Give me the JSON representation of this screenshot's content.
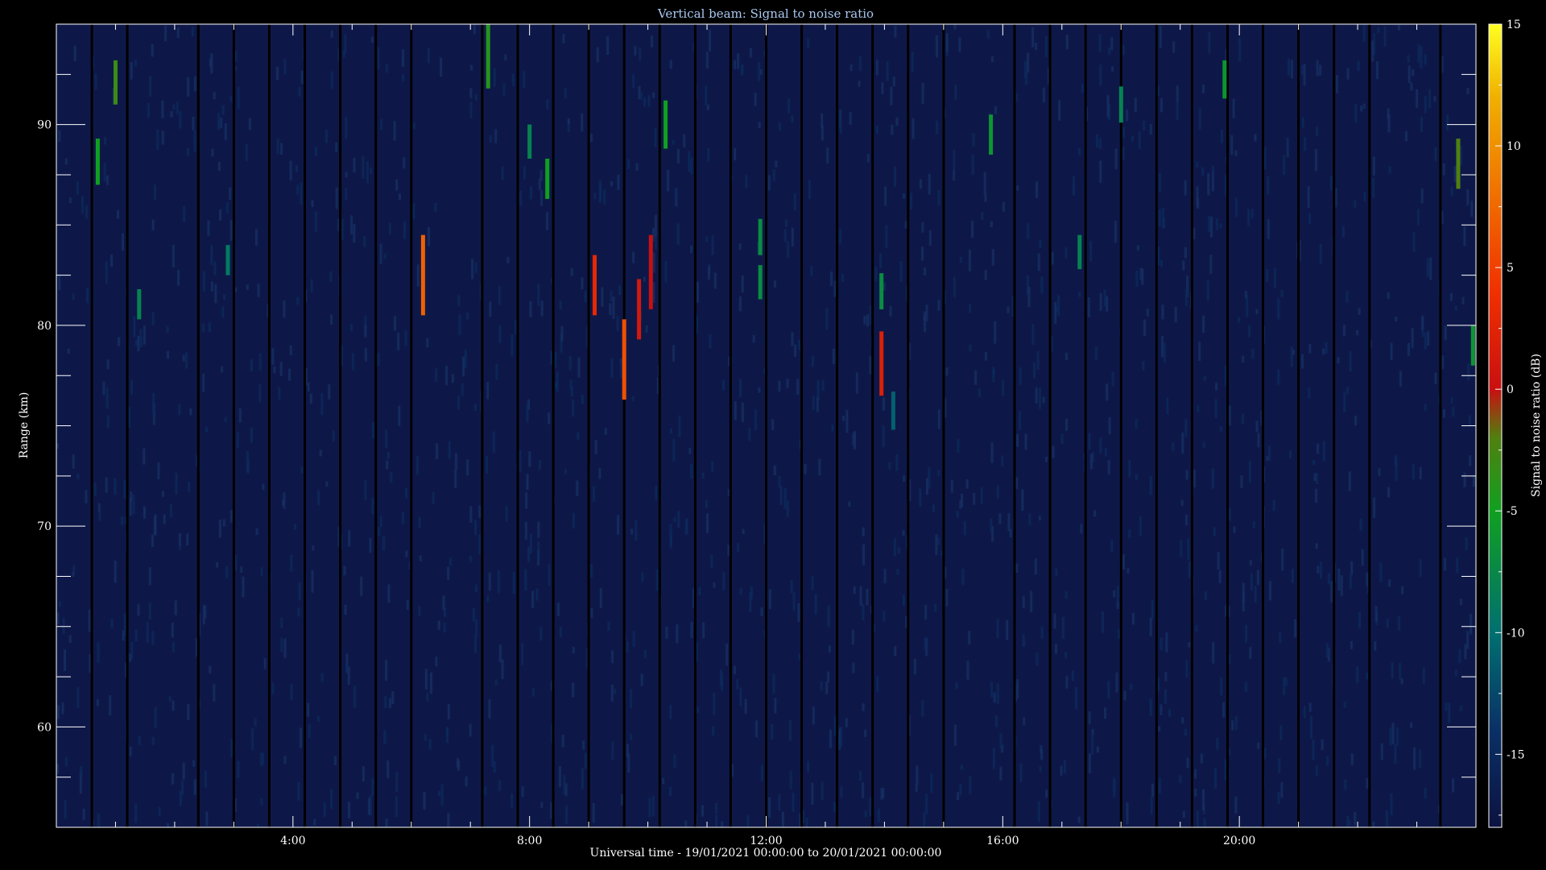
{
  "chart_data": {
    "type": "heatmap",
    "title": "Vertical beam: Signal to noise ratio",
    "xlabel": "Universal time - 19/01/2021 00:00:00 to 20/01/2021 00:00:00",
    "ylabel": "Range (km)",
    "colorbar_label": "Signal to noise ratio (dB)",
    "x_unit": "hours UT",
    "xlim": [
      0,
      24
    ],
    "ylim": [
      55,
      95
    ],
    "clim": [
      -18,
      15
    ],
    "x_ticks": [
      {
        "value": 4,
        "label": "4:00"
      },
      {
        "value": 8,
        "label": "8:00"
      },
      {
        "value": 12,
        "label": "12:00"
      },
      {
        "value": 16,
        "label": "16:00"
      },
      {
        "value": 20,
        "label": "20:00"
      }
    ],
    "y_ticks": [
      {
        "value": 60,
        "label": "60"
      },
      {
        "value": 70,
        "label": "70"
      },
      {
        "value": 80,
        "label": "80"
      },
      {
        "value": 90,
        "label": "90"
      }
    ],
    "colorbar_ticks": [
      {
        "value": 15,
        "label": "15"
      },
      {
        "value": 10,
        "label": "10"
      },
      {
        "value": 5,
        "label": "5"
      },
      {
        "value": 0,
        "label": "0"
      },
      {
        "value": -5,
        "label": "-5"
      },
      {
        "value": -10,
        "label": "-10"
      },
      {
        "value": -15,
        "label": "-15"
      }
    ],
    "colormap": [
      {
        "value": -18,
        "color": "#0c1240"
      },
      {
        "value": -14,
        "color": "#0a3066"
      },
      {
        "value": -10,
        "color": "#007070"
      },
      {
        "value": -5,
        "color": "#10a020"
      },
      {
        "value": -2,
        "color": "#508010"
      },
      {
        "value": 0,
        "color": "#c81010"
      },
      {
        "value": 4,
        "color": "#f03000"
      },
      {
        "value": 8,
        "color": "#f07000"
      },
      {
        "value": 12,
        "color": "#f0b000"
      },
      {
        "value": 15,
        "color": "#ffff20"
      }
    ],
    "background_level_db": -16,
    "data_gaps_hours": [
      0.6,
      1.2,
      2.4,
      3.0,
      3.6,
      4.2,
      4.8,
      5.4,
      6.0,
      7.2,
      7.8,
      8.4,
      9.0,
      9.6,
      10.2,
      10.8,
      11.4,
      12.0,
      12.6,
      13.2,
      13.8,
      14.4,
      15.0,
      16.2,
      16.8,
      17.4,
      18.0,
      18.6,
      19.2,
      19.8,
      20.4,
      21.0,
      21.6,
      22.2,
      23.4
    ],
    "echoes": [
      {
        "t": 0.7,
        "r1": 87.0,
        "r2": 89.3,
        "snr": -5
      },
      {
        "t": 1.0,
        "r1": 91.0,
        "r2": 93.2,
        "snr": -3
      },
      {
        "t": 1.4,
        "r1": 80.3,
        "r2": 81.8,
        "snr": -8
      },
      {
        "t": 2.9,
        "r1": 82.5,
        "r2": 84.0,
        "snr": -9
      },
      {
        "t": 6.2,
        "r1": 80.5,
        "r2": 84.5,
        "snr": 7
      },
      {
        "t": 7.3,
        "r1": 91.8,
        "r2": 95.0,
        "snr": -4
      },
      {
        "t": 8.0,
        "r1": 88.3,
        "r2": 90.0,
        "snr": -8
      },
      {
        "t": 8.3,
        "r1": 86.3,
        "r2": 88.3,
        "snr": -5
      },
      {
        "t": 9.1,
        "r1": 80.5,
        "r2": 83.5,
        "snr": 3
      },
      {
        "t": 9.6,
        "r1": 76.3,
        "r2": 80.3,
        "snr": 6
      },
      {
        "t": 9.85,
        "r1": 79.3,
        "r2": 82.3,
        "snr": 1
      },
      {
        "t": 10.05,
        "r1": 80.8,
        "r2": 84.5,
        "snr": 0
      },
      {
        "t": 10.3,
        "r1": 88.8,
        "r2": 91.2,
        "snr": -5
      },
      {
        "t": 11.9,
        "r1": 83.5,
        "r2": 85.3,
        "snr": -7
      },
      {
        "t": 11.9,
        "r1": 81.3,
        "r2": 83.0,
        "snr": -7
      },
      {
        "t": 13.95,
        "r1": 76.5,
        "r2": 79.7,
        "snr": 2
      },
      {
        "t": 13.95,
        "r1": 80.8,
        "r2": 82.6,
        "snr": -7
      },
      {
        "t": 14.15,
        "r1": 74.8,
        "r2": 76.7,
        "snr": -11
      },
      {
        "t": 15.8,
        "r1": 88.5,
        "r2": 90.5,
        "snr": -6
      },
      {
        "t": 17.3,
        "r1": 82.8,
        "r2": 84.5,
        "snr": -8
      },
      {
        "t": 18.0,
        "r1": 90.1,
        "r2": 91.9,
        "snr": -8
      },
      {
        "t": 19.75,
        "r1": 91.3,
        "r2": 93.2,
        "snr": -6
      },
      {
        "t": 23.7,
        "r1": 86.8,
        "r2": 89.3,
        "snr": -2
      },
      {
        "t": 23.95,
        "r1": 78.0,
        "r2": 80.0,
        "snr": -6
      }
    ]
  }
}
